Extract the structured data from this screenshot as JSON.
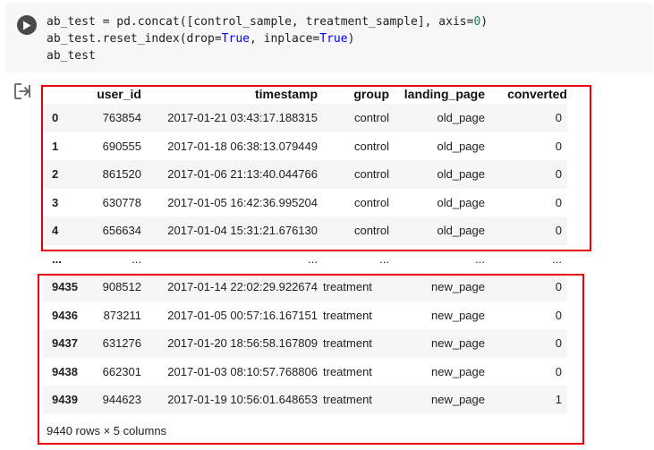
{
  "code_cell": {
    "lines": [
      [
        {
          "t": "ab_test = pd.concat([control_sample, treatment_sample], axis="
        },
        {
          "t": "0",
          "c": "num"
        },
        {
          "t": ")"
        }
      ],
      [
        {
          "t": "ab_test.reset_index(drop="
        },
        {
          "t": "True",
          "c": "kw"
        },
        {
          "t": ", inplace="
        },
        {
          "t": "True",
          "c": "kw"
        },
        {
          "t": ")"
        }
      ],
      [
        {
          "t": "ab_test"
        }
      ]
    ],
    "run_icon": "play-icon"
  },
  "output": {
    "icon": "output-redirect-icon",
    "table": {
      "columns": [
        "",
        "user_id",
        "timestamp",
        "group",
        "landing_page",
        "converted"
      ],
      "rows": [
        {
          "index": "0",
          "user_id": "763854",
          "timestamp": "2017-01-21 03:43:17.188315",
          "group": "control",
          "landing_page": "old_page",
          "converted": "0"
        },
        {
          "index": "1",
          "user_id": "690555",
          "timestamp": "2017-01-18 06:38:13.079449",
          "group": "control",
          "landing_page": "old_page",
          "converted": "0"
        },
        {
          "index": "2",
          "user_id": "861520",
          "timestamp": "2017-01-06 21:13:40.044766",
          "group": "control",
          "landing_page": "old_page",
          "converted": "0"
        },
        {
          "index": "3",
          "user_id": "630778",
          "timestamp": "2017-01-05 16:42:36.995204",
          "group": "control",
          "landing_page": "old_page",
          "converted": "0"
        },
        {
          "index": "4",
          "user_id": "656634",
          "timestamp": "2017-01-04 15:31:21.676130",
          "group": "control",
          "landing_page": "old_page",
          "converted": "0"
        },
        {
          "index": "...",
          "user_id": "...",
          "timestamp": "...",
          "group": "...",
          "landing_page": "...",
          "converted": "...",
          "ellipsis": true
        },
        {
          "index": "9435",
          "user_id": "908512",
          "timestamp": "2017-01-14 22:02:29.922674",
          "group": "treatment",
          "landing_page": "new_page",
          "converted": "0"
        },
        {
          "index": "9436",
          "user_id": "873211",
          "timestamp": "2017-01-05 00:57:16.167151",
          "group": "treatment",
          "landing_page": "new_page",
          "converted": "0"
        },
        {
          "index": "9437",
          "user_id": "631276",
          "timestamp": "2017-01-20 18:56:58.167809",
          "group": "treatment",
          "landing_page": "new_page",
          "converted": "0"
        },
        {
          "index": "9438",
          "user_id": "662301",
          "timestamp": "2017-01-03 08:10:57.768806",
          "group": "treatment",
          "landing_page": "new_page",
          "converted": "0"
        },
        {
          "index": "9439",
          "user_id": "944623",
          "timestamp": "2017-01-19 10:56:01.648653",
          "group": "treatment",
          "landing_page": "new_page",
          "converted": "1"
        }
      ],
      "footer": "9440 rows × 5 columns"
    }
  },
  "colors": {
    "highlight_border": "#e8000b",
    "code_background": "#f7f7f7",
    "keyword": "#0000ff",
    "number": "#098658"
  }
}
